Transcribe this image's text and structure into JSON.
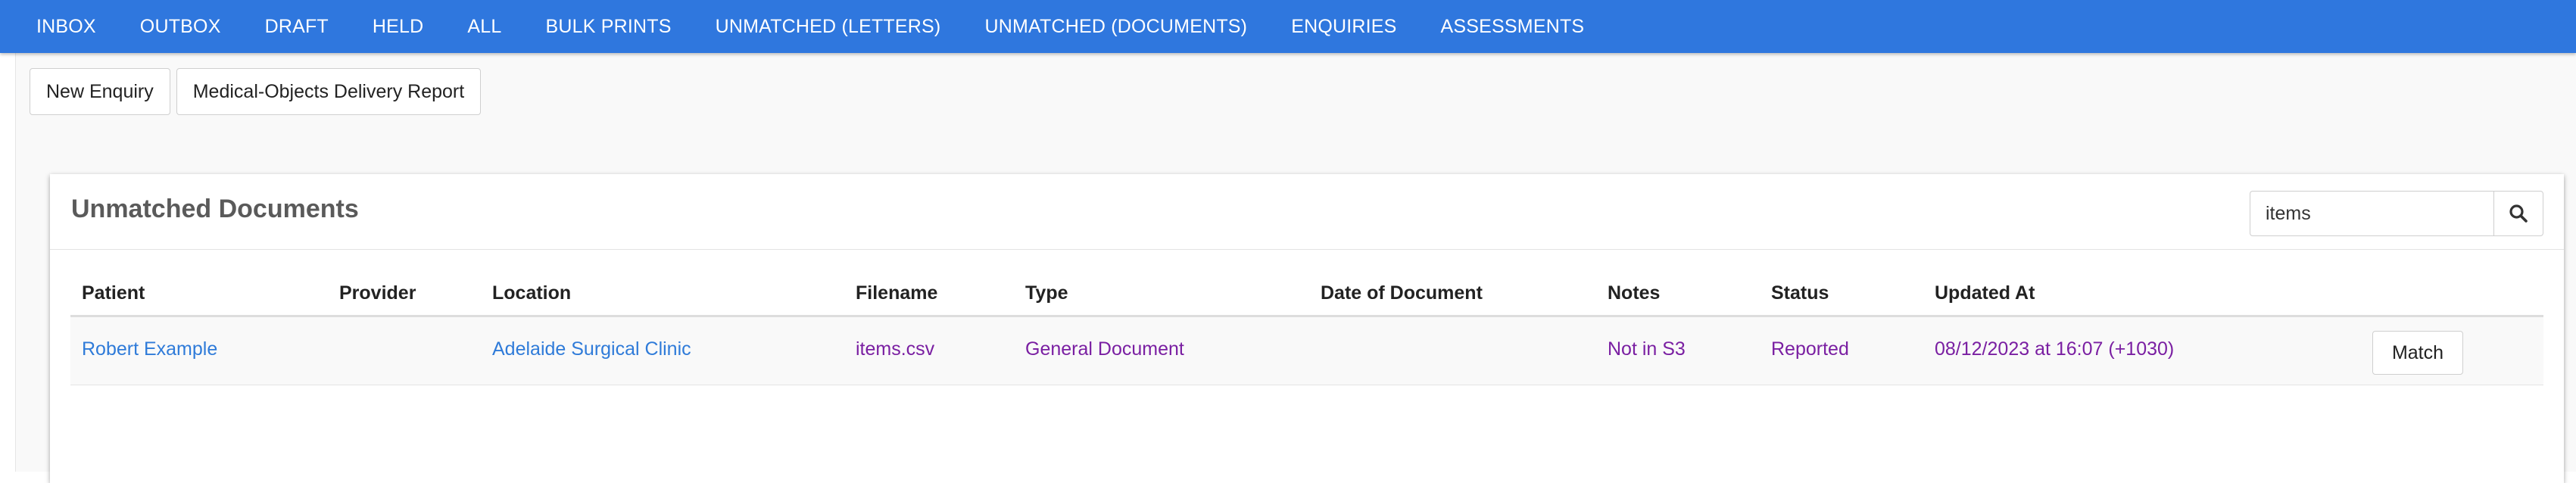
{
  "nav": {
    "items": [
      {
        "label": "INBOX"
      },
      {
        "label": "OUTBOX"
      },
      {
        "label": "DRAFT"
      },
      {
        "label": "HELD"
      },
      {
        "label": "ALL"
      },
      {
        "label": "BULK PRINTS"
      },
      {
        "label": "UNMATCHED (LETTERS)"
      },
      {
        "label": "UNMATCHED (DOCUMENTS)"
      },
      {
        "label": "ENQUIRIES"
      },
      {
        "label": "ASSESSMENTS"
      }
    ],
    "bg_color": "#2f77de"
  },
  "actions": {
    "new_enquiry_label": "New Enquiry",
    "delivery_report_label": "Medical-Objects Delivery Report"
  },
  "panel": {
    "title": "Unmatched Documents",
    "search": {
      "value": "items",
      "icon": "search-icon"
    }
  },
  "table": {
    "headers": {
      "patient": "Patient",
      "provider": "Provider",
      "location": "Location",
      "filename": "Filename",
      "type": "Type",
      "date": "Date of Document",
      "notes": "Notes",
      "status": "Status",
      "updated": "Updated At"
    },
    "rows": [
      {
        "patient": "Robert Example",
        "provider": "",
        "location": "Adelaide Surgical Clinic",
        "filename": "items.csv",
        "type": "General Document",
        "date": "",
        "notes": "Not in S3",
        "status": "Reported",
        "updated": "08/12/2023 at 16:07 (+1030)",
        "action_label": "Match"
      }
    ]
  },
  "colors": {
    "link": "#2f7bd9",
    "purple_text": "#7a1fa2"
  }
}
